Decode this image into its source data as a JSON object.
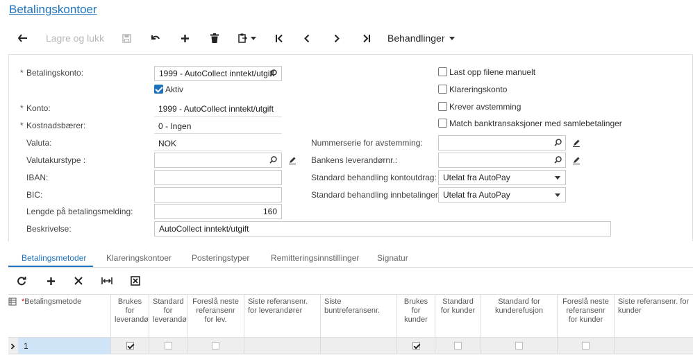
{
  "page_title": "Betalingskontoer",
  "toolbar": {
    "back_icon": "arrow-left-icon",
    "save_close_label": "Lagre og lukk",
    "save_icon": "save-icon",
    "undo_icon": "undo-icon",
    "add_icon": "plus-icon",
    "delete_icon": "trash-icon",
    "clipboard_icon": "clipboard-icon",
    "first_icon": "first-record-icon",
    "prev_icon": "previous-icon",
    "next_icon": "next-icon",
    "last_icon": "last-record-icon",
    "actions_label": "Behandlinger"
  },
  "form": {
    "payment_account_label": "Betalingskonto:",
    "payment_account_value": "1999 - AutoCollect inntekt/utgift",
    "active_label": "Aktiv",
    "active_checked": true,
    "account_label": "Konto:",
    "account_value": "1999 - AutoCollect inntekt/utgift",
    "cost_label": "Kostnadsbærer:",
    "cost_value": "0 - Ingen",
    "currency_label": "Valuta:",
    "currency_value": "NOK",
    "rate_type_label": "Valutakurstype :",
    "rate_type_value": "",
    "iban_label": "IBAN:",
    "iban_value": "",
    "bic_label": "BIC:",
    "bic_value": "",
    "msg_length_label": "Lengde på betalingsmelding:",
    "msg_length_value": "160",
    "description_label": "Beskrivelse:",
    "description_value": "AutoCollect inntekt/utgift",
    "upload_manual_label": "Last opp filene manuelt",
    "clearing_account_label": "Klareringskonto",
    "requires_reconciliation_label": "Krever avstemming",
    "match_bank_label": "Match banktransaksjoner med samlebetalinger",
    "number_series_label": "Nummerserie for avstemming:",
    "number_series_value": "",
    "bank_supplier_label": "Bankens leverandørnr.:",
    "bank_supplier_value": "",
    "std_statement_label": "Standard behandling kontoutdrag:",
    "std_statement_value": "Utelat fra AutoPay",
    "std_incoming_label": "Standard behandling innbetalinger:",
    "std_incoming_value": "Utelat fra AutoPay"
  },
  "tabs": [
    "Betalingsmetoder",
    "Klareringskontoer",
    "Posteringstyper",
    "Remitteringsinnstillinger",
    "Signatur"
  ],
  "grid": {
    "headers": [
      "Betalingsmetode",
      "Brukes for leverandører",
      "Standard for leverandører",
      "Foreslå neste referansenr for lev.",
      "Siste referansenr. for leverandører",
      "Siste buntreferansenr.",
      "Brukes for kunder",
      "Standard for kunder",
      "Standard for kunderefusjon",
      "Foreslå neste referansenr for kunder",
      "Siste referansenr. for kunder"
    ],
    "rows": [
      {
        "method": "1",
        "use_supplier": true,
        "std_supplier": false,
        "suggest_next_supplier": false,
        "use_customer": true,
        "std_customer": false,
        "std_refund": false,
        "suggest_next_customer": false
      }
    ]
  }
}
